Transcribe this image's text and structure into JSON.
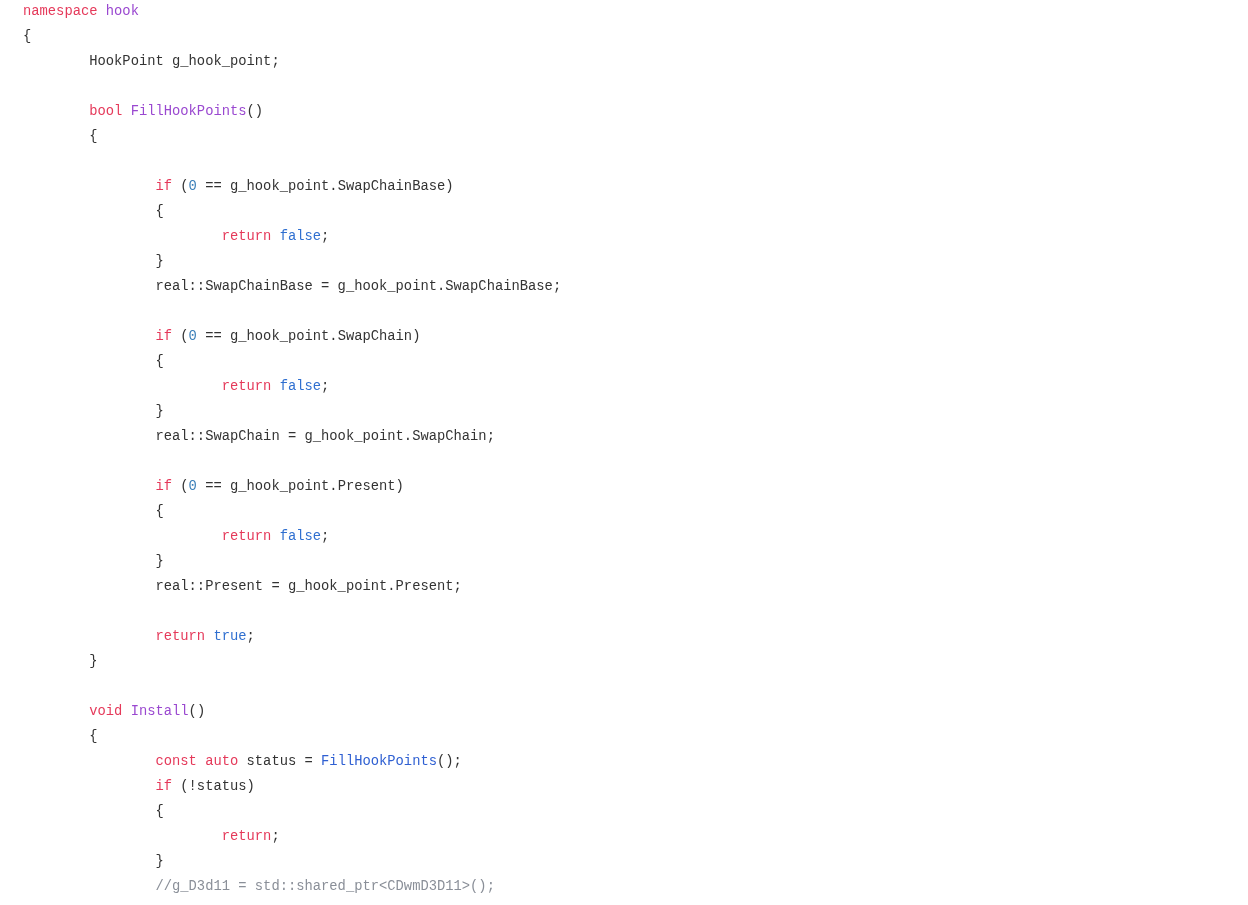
{
  "code_lines": [
    {
      "kind": "code",
      "tokens": [
        {
          "text": "namespace",
          "kind": "keyword"
        },
        {
          "text": " hook",
          "kind": "name"
        }
      ]
    },
    {
      "kind": "code",
      "tokens": [
        {
          "text": "{",
          "kind": "plain"
        }
      ]
    },
    {
      "kind": "code",
      "tokens": [
        {
          "text": "        HookPoint g_hook_point;",
          "kind": "plain"
        }
      ]
    },
    {
      "kind": "blank"
    },
    {
      "kind": "code",
      "tokens": [
        {
          "text": "        bool",
          "kind": "keyword"
        },
        {
          "text": " FillHookPoints",
          "kind": "name"
        },
        {
          "text": "()",
          "kind": "plain"
        }
      ]
    },
    {
      "kind": "code",
      "tokens": [
        {
          "text": "        {",
          "kind": "plain"
        }
      ]
    },
    {
      "kind": "blank"
    },
    {
      "kind": "code",
      "tokens": [
        {
          "text": "                if",
          "kind": "keyword"
        },
        {
          "text": " (",
          "kind": "plain"
        },
        {
          "text": "0",
          "kind": "number"
        },
        {
          "text": " == g_hook_point.SwapChainBase)",
          "kind": "plain"
        }
      ]
    },
    {
      "kind": "code",
      "tokens": [
        {
          "text": "                {",
          "kind": "plain"
        }
      ]
    },
    {
      "kind": "code",
      "tokens": [
        {
          "text": "                        return",
          "kind": "keyword"
        },
        {
          "text": " false",
          "kind": "literal"
        },
        {
          "text": ";",
          "kind": "plain"
        }
      ]
    },
    {
      "kind": "code",
      "tokens": [
        {
          "text": "                }",
          "kind": "plain"
        }
      ]
    },
    {
      "kind": "code",
      "tokens": [
        {
          "text": "                real::SwapChainBase = g_hook_point.SwapChainBase;",
          "kind": "plain"
        }
      ]
    },
    {
      "kind": "blank"
    },
    {
      "kind": "code",
      "tokens": [
        {
          "text": "                if",
          "kind": "keyword"
        },
        {
          "text": " (",
          "kind": "plain"
        },
        {
          "text": "0",
          "kind": "number"
        },
        {
          "text": " == g_hook_point.SwapChain)",
          "kind": "plain"
        }
      ]
    },
    {
      "kind": "code",
      "tokens": [
        {
          "text": "                {",
          "kind": "plain"
        }
      ]
    },
    {
      "kind": "code",
      "tokens": [
        {
          "text": "                        return",
          "kind": "keyword"
        },
        {
          "text": " false",
          "kind": "literal"
        },
        {
          "text": ";",
          "kind": "plain"
        }
      ]
    },
    {
      "kind": "code",
      "tokens": [
        {
          "text": "                }",
          "kind": "plain"
        }
      ]
    },
    {
      "kind": "code",
      "tokens": [
        {
          "text": "                real::SwapChain = g_hook_point.SwapChain;",
          "kind": "plain"
        }
      ]
    },
    {
      "kind": "blank"
    },
    {
      "kind": "code",
      "tokens": [
        {
          "text": "                if",
          "kind": "keyword"
        },
        {
          "text": " (",
          "kind": "plain"
        },
        {
          "text": "0",
          "kind": "number"
        },
        {
          "text": " == g_hook_point.Present)",
          "kind": "plain"
        }
      ]
    },
    {
      "kind": "code",
      "tokens": [
        {
          "text": "                {",
          "kind": "plain"
        }
      ]
    },
    {
      "kind": "code",
      "tokens": [
        {
          "text": "                        return",
          "kind": "keyword"
        },
        {
          "text": " false",
          "kind": "literal"
        },
        {
          "text": ";",
          "kind": "plain"
        }
      ]
    },
    {
      "kind": "code",
      "tokens": [
        {
          "text": "                }",
          "kind": "plain"
        }
      ]
    },
    {
      "kind": "code",
      "tokens": [
        {
          "text": "                real::Present = g_hook_point.Present;",
          "kind": "plain"
        }
      ]
    },
    {
      "kind": "blank"
    },
    {
      "kind": "code",
      "tokens": [
        {
          "text": "                return",
          "kind": "keyword"
        },
        {
          "text": " true",
          "kind": "literal"
        },
        {
          "text": ";",
          "kind": "plain"
        }
      ]
    },
    {
      "kind": "code",
      "tokens": [
        {
          "text": "        }",
          "kind": "plain"
        }
      ]
    },
    {
      "kind": "blank"
    },
    {
      "kind": "code",
      "tokens": [
        {
          "text": "        void",
          "kind": "keyword"
        },
        {
          "text": " Install",
          "kind": "name"
        },
        {
          "text": "()",
          "kind": "plain"
        }
      ]
    },
    {
      "kind": "code",
      "tokens": [
        {
          "text": "        {",
          "kind": "plain"
        }
      ]
    },
    {
      "kind": "code",
      "tokens": [
        {
          "text": "                const",
          "kind": "keyword"
        },
        {
          "text": " auto",
          "kind": "keyword"
        },
        {
          "text": " status = ",
          "kind": "plain"
        },
        {
          "text": "FillHookPoints",
          "kind": "call"
        },
        {
          "text": "();",
          "kind": "plain"
        }
      ]
    },
    {
      "kind": "code",
      "tokens": [
        {
          "text": "                if",
          "kind": "keyword"
        },
        {
          "text": " (!status)",
          "kind": "plain"
        }
      ]
    },
    {
      "kind": "code",
      "tokens": [
        {
          "text": "                {",
          "kind": "plain"
        }
      ]
    },
    {
      "kind": "code",
      "tokens": [
        {
          "text": "                        return",
          "kind": "keyword"
        },
        {
          "text": ";",
          "kind": "plain"
        }
      ]
    },
    {
      "kind": "code",
      "tokens": [
        {
          "text": "                }",
          "kind": "plain"
        }
      ]
    },
    {
      "kind": "code",
      "tokens": [
        {
          "text": "                //g_D3d11 = std::shared_ptr<CDwmD3D11>();",
          "kind": "comment"
        }
      ]
    }
  ]
}
